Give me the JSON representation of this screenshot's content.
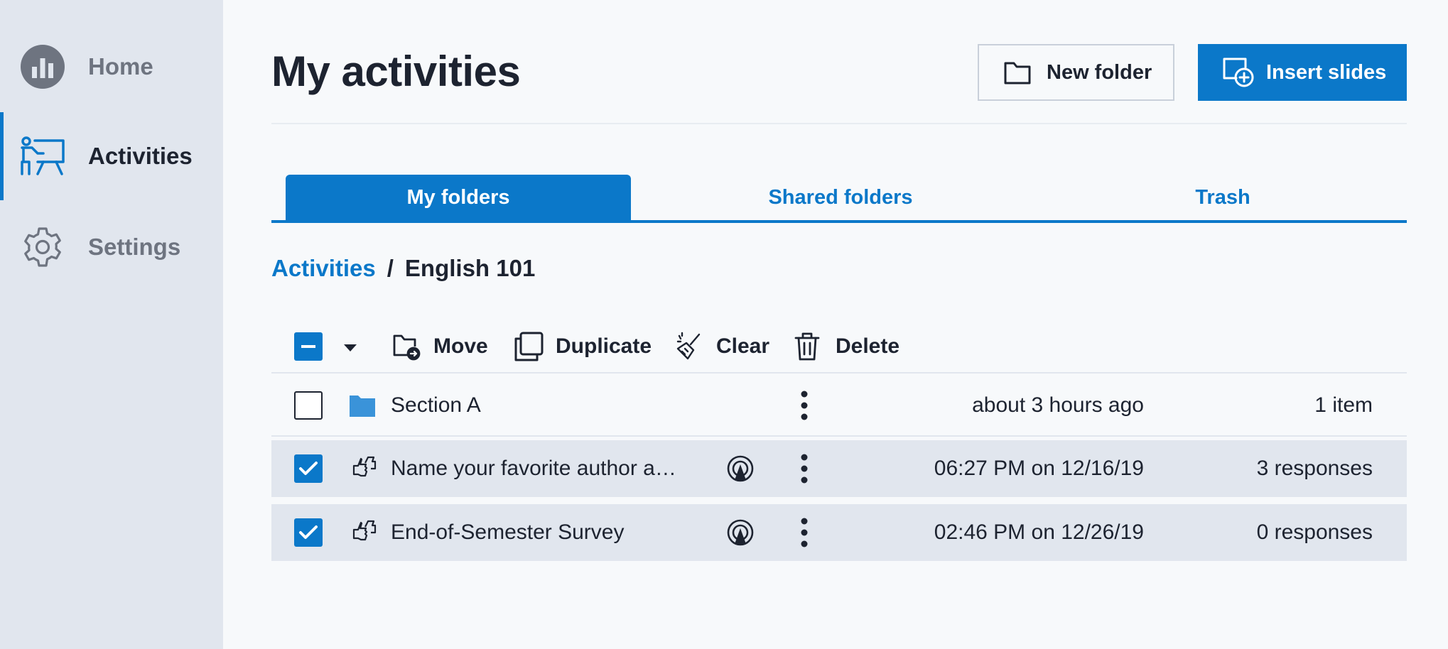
{
  "sidebar": {
    "items": [
      {
        "label": "Home",
        "icon": "home-chart-icon",
        "active": false
      },
      {
        "label": "Activities",
        "icon": "presenter-icon",
        "active": true
      },
      {
        "label": "Settings",
        "icon": "gear-icon",
        "active": false
      }
    ]
  },
  "header": {
    "title": "My activities",
    "new_folder_label": "New folder",
    "insert_slides_label": "Insert slides"
  },
  "tabs": [
    {
      "label": "My folders",
      "active": true
    },
    {
      "label": "Shared folders",
      "active": false
    },
    {
      "label": "Trash",
      "active": false
    }
  ],
  "breadcrumb": {
    "root": "Activities",
    "separator": "/",
    "current": "English 101"
  },
  "toolbar": {
    "select_all_state": "indeterminate",
    "move_label": "Move",
    "duplicate_label": "Duplicate",
    "clear_label": "Clear",
    "delete_label": "Delete"
  },
  "rows": [
    {
      "type": "folder",
      "name": "Section A",
      "date": "about 3 hours ago",
      "count": "1 item",
      "checked": false
    },
    {
      "type": "activity",
      "name": "Name your favorite author a…",
      "date": "06:27 PM on 12/16/19",
      "count": "3 responses",
      "checked": true
    },
    {
      "type": "activity",
      "name": "End-of-Semester Survey",
      "date": "02:46 PM on 12/26/19",
      "count": "0 responses",
      "checked": true
    }
  ],
  "colors": {
    "accent": "#0b78c9",
    "sidebar_bg": "#e1e6ee",
    "page_bg": "#f7f9fb",
    "text": "#1d2330",
    "muted_text": "#6e7480",
    "folder": "#3a93d9"
  }
}
